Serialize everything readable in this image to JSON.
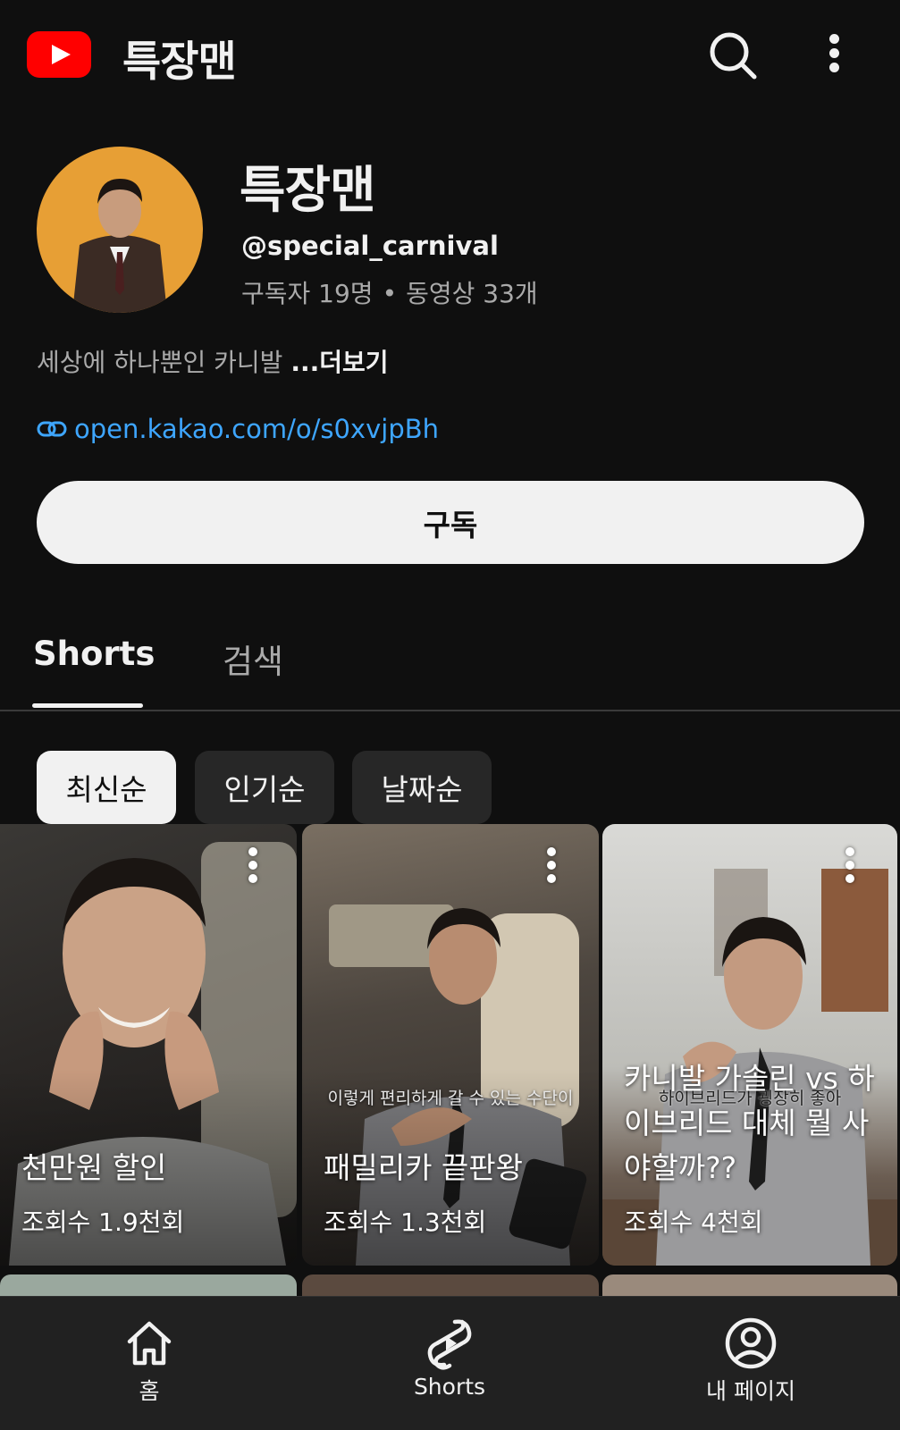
{
  "app": {
    "title": "특장맨",
    "icons": {
      "logo": "youtube-logo-icon",
      "search": "search-icon",
      "more": "more-vert-icon"
    }
  },
  "channel": {
    "name": "특장맨",
    "handle": "@special_carnival",
    "subscribers": "구독자 19명",
    "separator": "•",
    "videos": "동영상 33개",
    "description": "세상에 하나뿐인 카니발 ",
    "more_label": "...더보기",
    "link": "open.kakao.com/o/s0xvjpBh",
    "subscribe_label": "구독"
  },
  "tabs": [
    {
      "label": "Shorts",
      "active": true
    },
    {
      "label": "검색",
      "active": false
    }
  ],
  "sort_chips": [
    {
      "label": "최신순",
      "active": true
    },
    {
      "label": "인기순",
      "active": false
    },
    {
      "label": "날짜순",
      "active": false
    }
  ],
  "shorts": [
    {
      "title": "천만원 할인",
      "views": "조회수 1.9천회",
      "caption": ""
    },
    {
      "title": "패밀리카 끝판왕",
      "views": "조회수 1.3천회",
      "caption": "이렇게 편리하게 갈 수 있는 수단이"
    },
    {
      "title": "카니발 가솔린 vs 하이브리드 대체 뭘 사야할까??",
      "views": "조회수 4천회",
      "caption": "하이브리드가 굉장히 좋아"
    }
  ],
  "bottom_nav": [
    {
      "label": "홈",
      "icon": "home-icon"
    },
    {
      "label": "Shorts",
      "icon": "shorts-icon"
    },
    {
      "label": "내 페이지",
      "icon": "account-icon"
    }
  ],
  "colors": {
    "background": "#0f0f0f",
    "accent_red": "#ff0000",
    "link": "#3ea6ff",
    "secondary_text": "#aaaaaa"
  }
}
